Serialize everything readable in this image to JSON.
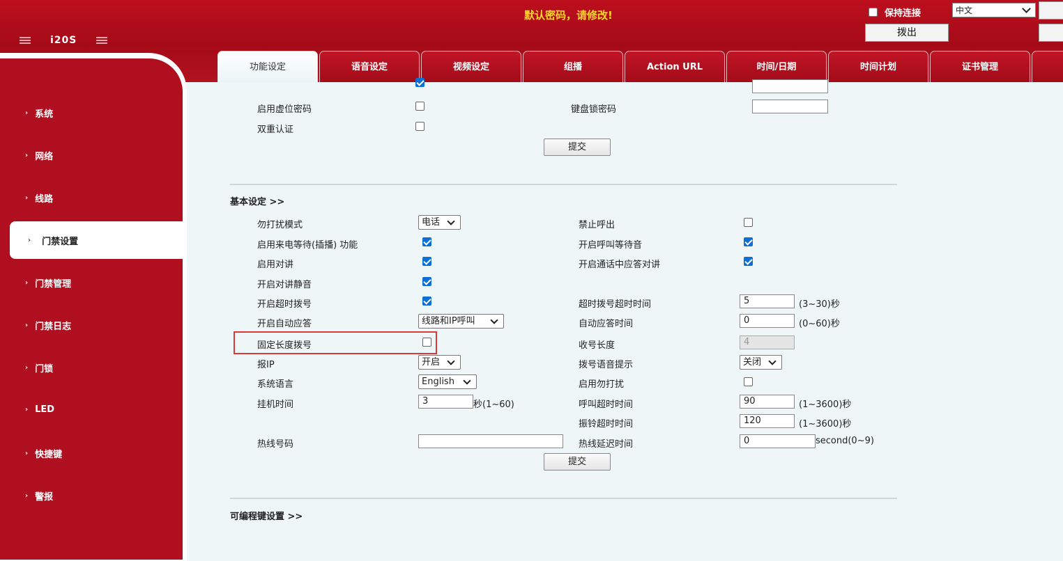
{
  "header": {
    "warning": "默认密码，请修改!",
    "keep_connection": "保持连接",
    "language": "中文",
    "hang_up": "拨出",
    "product": "i20S"
  },
  "sidebar": {
    "items": [
      {
        "label": "系统"
      },
      {
        "label": "网络"
      },
      {
        "label": "线路"
      },
      {
        "label": "门禁设置",
        "active": true
      },
      {
        "label": "门禁管理"
      },
      {
        "label": "门禁日志"
      },
      {
        "label": "门锁"
      },
      {
        "label": "LED"
      },
      {
        "label": "快捷键"
      },
      {
        "label": "警报"
      }
    ]
  },
  "tabs": [
    {
      "label": "功能设定",
      "active": true
    },
    {
      "label": "语音设定"
    },
    {
      "label": "视频设定"
    },
    {
      "label": "组播"
    },
    {
      "label": "Action URL"
    },
    {
      "label": "时间/日期"
    },
    {
      "label": "时间计划"
    },
    {
      "label": "证书管理"
    }
  ],
  "security": {
    "virtual_password_label": "启用虚位密码",
    "keypad_lock_password_label": "键盘锁密码",
    "keypad_lock_password_value": "",
    "dual_auth_label": "双重认证",
    "submit": "提交"
  },
  "basic": {
    "title": "基本设定 >>",
    "dnd_mode_label": "勿打扰模式",
    "dnd_mode_value": "电话",
    "disable_outgoing_label": "禁止呼出",
    "call_waiting_label": "启用来电等待(插播) 功能",
    "ringback_label": "开启呼叫等待音",
    "intercom_label": "启用对讲",
    "answer_intercom_in_call_label": "开启通话中应答对讲",
    "intercom_mute_label": "开启对讲静音",
    "timeout_dial_label": "开启超时拨号",
    "timeout_dial_time_label": "超时拨号超时时间",
    "timeout_dial_time_value": "5",
    "timeout_dial_time_range": "(3~30)秒",
    "auto_answer_label": "开启自动应答",
    "auto_answer_value": "线路和IP呼叫",
    "auto_answer_time_label": "自动应答时间",
    "auto_answer_time_value": "0",
    "auto_answer_time_range": "(0~60)秒",
    "fixed_length_label": "固定长度拨号",
    "receive_length_label": "收号长度",
    "receive_length_value": "4",
    "report_ip_label": "报IP",
    "report_ip_value": "开启",
    "dial_voice_prompt_label": "拨号语音提示",
    "dial_voice_prompt_value": "关闭",
    "system_language_label": "系统语言",
    "system_language_value": "English",
    "enable_dnd_label": "启用勿打扰",
    "hangup_time_label": "挂机时间",
    "hangup_time_value": "3",
    "hangup_time_range": "秒(1~60)",
    "call_timeout_label": "呼叫超时时间",
    "call_timeout_value": "90",
    "call_timeout_range": "(1~3600)秒",
    "ring_timeout_label": "振铃超时时间",
    "ring_timeout_value": "120",
    "ring_timeout_range": "(1~3600)秒",
    "hotline_label": "热线号码",
    "hotline_value": "",
    "hotline_delay_label": "热线延迟时间",
    "hotline_delay_value": "0",
    "hotline_delay_range": "second(0~9)",
    "submit": "提交"
  },
  "programmable": {
    "title": "可编程键设置 >>"
  },
  "checkbox_states": {
    "virtual_password": false,
    "dual_auth": false,
    "disable_outgoing": false,
    "call_waiting": true,
    "ringback": true,
    "intercom": true,
    "answer_intercom_in_call": true,
    "intercom_mute": true,
    "timeout_dial": true,
    "fixed_length": false,
    "enable_dnd": false
  },
  "colors": {
    "brand_red": "#b00f1f",
    "warning_yellow": "#f8d42a",
    "checkbox_blue": "#0b6fd3",
    "highlight_red": "#d63a3a"
  }
}
